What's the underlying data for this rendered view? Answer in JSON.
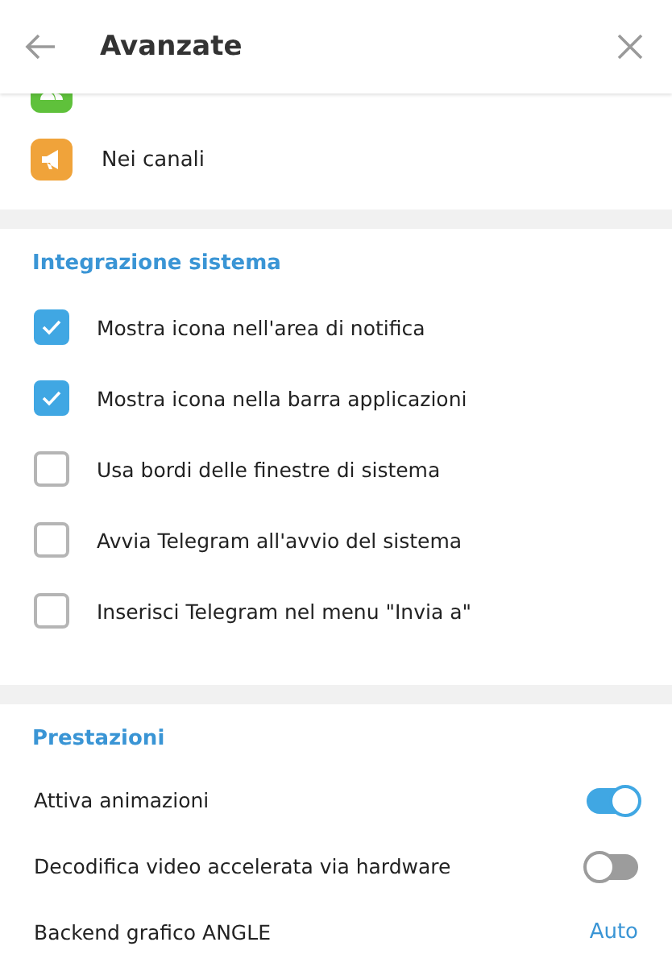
{
  "header": {
    "title": "Avanzate"
  },
  "chat_types": [
    {
      "kind": "groups",
      "color": "#5fc13b"
    },
    {
      "label": "Nei canali",
      "kind": "channels",
      "color": "#f0a33a"
    }
  ],
  "system_integration": {
    "title": "Integrazione sistema",
    "options": [
      {
        "label": "Mostra icona nell'area di notifica",
        "checked": true
      },
      {
        "label": "Mostra icona nella barra applicazioni",
        "checked": true
      },
      {
        "label": "Usa bordi delle finestre di sistema",
        "checked": false
      },
      {
        "label": "Avvia Telegram all'avvio del sistema",
        "checked": false
      },
      {
        "label": "Inserisci Telegram nel menu \"Invia a\"",
        "checked": false
      }
    ]
  },
  "performance": {
    "title": "Prestazioni",
    "rows": [
      {
        "kind": "toggle",
        "label": "Attiva animazioni",
        "on": true
      },
      {
        "kind": "toggle",
        "label": "Decodifica video accelerata via hardware",
        "on": false
      },
      {
        "kind": "value",
        "label": "Backend grafico ANGLE",
        "value": "Auto"
      }
    ]
  }
}
